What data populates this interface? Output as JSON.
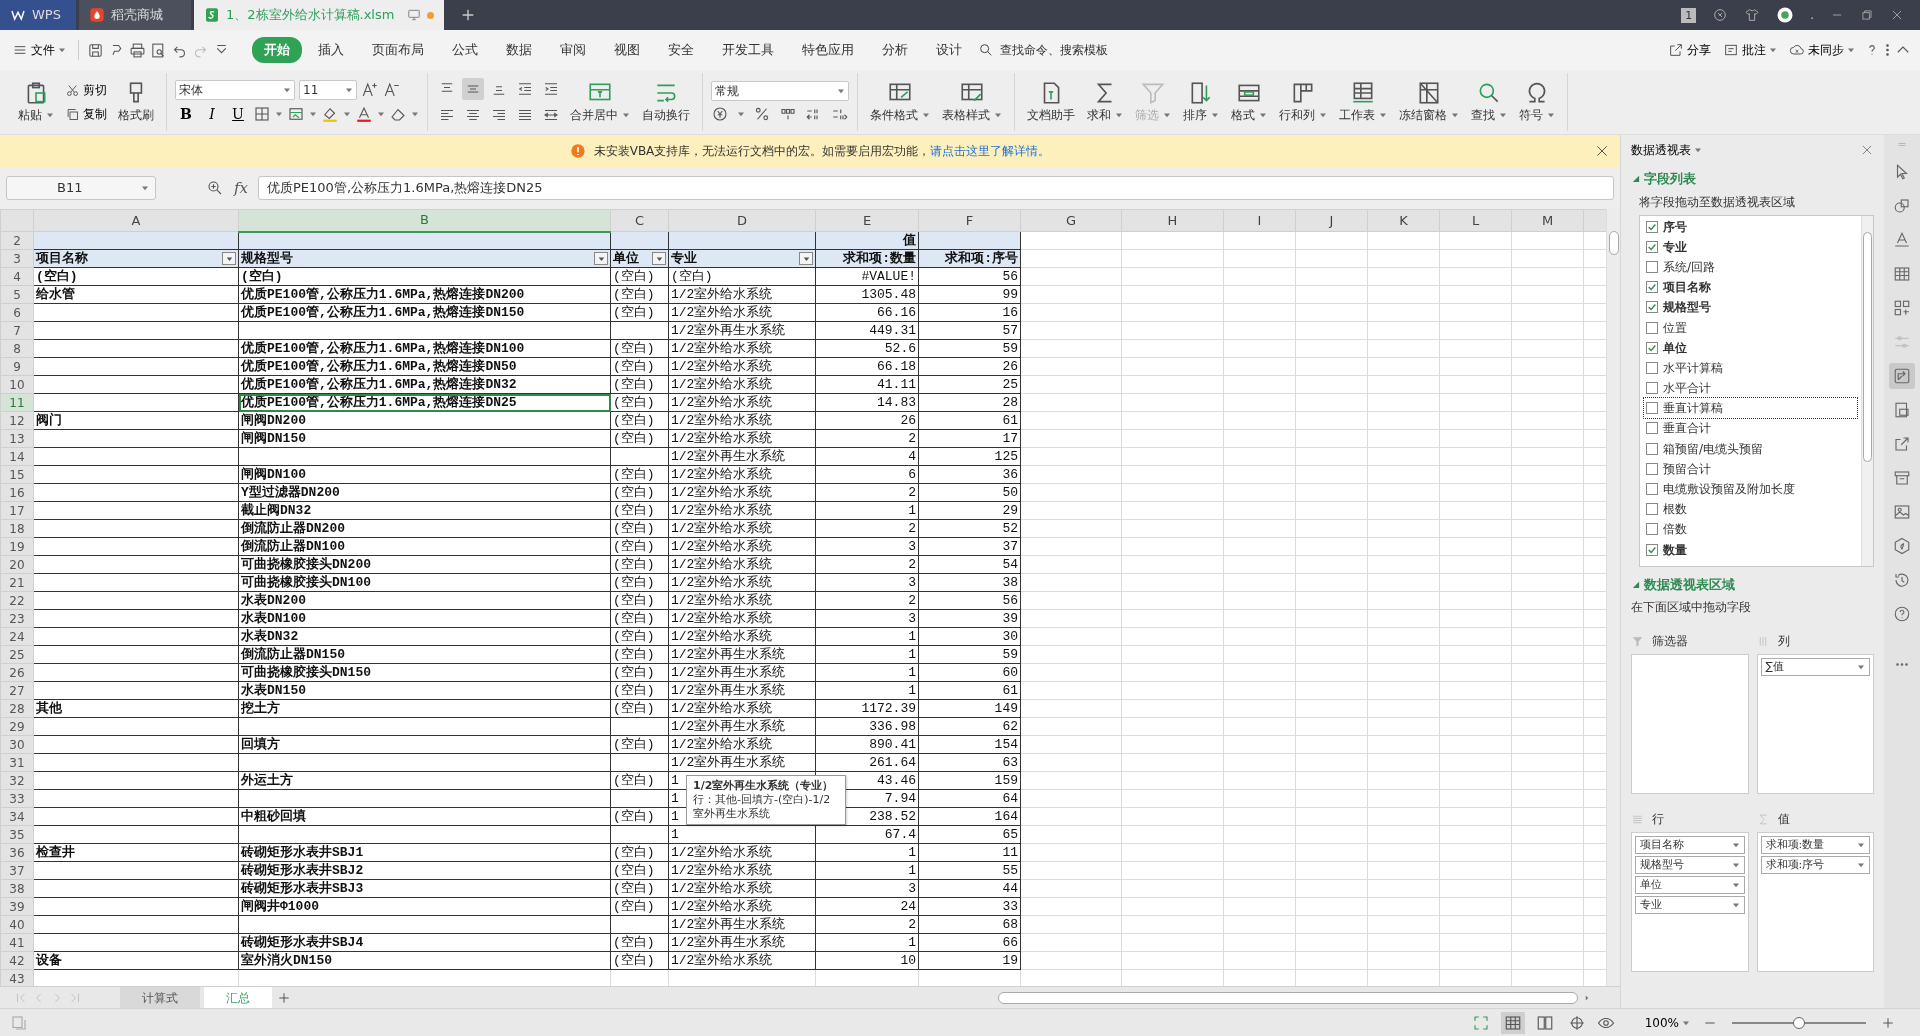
{
  "title_bar": {
    "tabs": [
      {
        "label": "WPS",
        "kind": "app",
        "selected": false,
        "modified": false
      },
      {
        "label": "稻壳商城",
        "kind": "store",
        "selected": false,
        "modified": false
      },
      {
        "label": "1、2栋室外给水计算稿.xlsm",
        "kind": "document",
        "selected": true,
        "modified": true
      }
    ],
    "window_badge": "1",
    "user": "."
  },
  "menu_bar": {
    "file": "文件",
    "tabs": [
      {
        "label": "开始",
        "selected": true
      },
      {
        "label": "插入",
        "selected": false
      },
      {
        "label": "页面布局",
        "selected": false
      },
      {
        "label": "公式",
        "selected": false
      },
      {
        "label": "数据",
        "selected": false
      },
      {
        "label": "审阅",
        "selected": false
      },
      {
        "label": "视图",
        "selected": false
      },
      {
        "label": "安全",
        "selected": false
      },
      {
        "label": "开发工具",
        "selected": false
      },
      {
        "label": "特色应用",
        "selected": false
      },
      {
        "label": "分析",
        "selected": false
      },
      {
        "label": "设计",
        "selected": false
      }
    ],
    "search": {
      "placeholder": "查找命令、搜索模板"
    },
    "actions": [
      {
        "label": "分享",
        "dropdown": false
      },
      {
        "label": "批注",
        "dropdown": true
      },
      {
        "label": "未同步",
        "dropdown": true
      }
    ]
  },
  "ribbon": {
    "paste": {
      "label": "粘贴",
      "dropdown": true
    },
    "clip_buttons": [
      "剪切",
      "复制"
    ],
    "format_painter": "格式刷",
    "font": {
      "name": "宋体",
      "size": "11"
    },
    "font_styles": [
      "B",
      "I",
      "U"
    ],
    "alignment_buttons": [
      {
        "selected": false
      },
      {
        "selected": true
      },
      {
        "selected": false
      },
      {
        "selected": false
      },
      {
        "selected": false
      },
      {
        "selected": false
      },
      {
        "selected": false
      },
      {
        "selected": false
      },
      {
        "selected": false
      },
      {
        "selected": false
      }
    ],
    "merge_buttons": [
      {
        "label": "合并居中",
        "dropdown": true
      },
      {
        "label": "自动换行",
        "dropdown": false
      }
    ],
    "number_format": "常规",
    "tools": [
      {
        "label": "条件格式",
        "dropdown": true,
        "disabled": false
      },
      {
        "label": "表格样式",
        "dropdown": true,
        "disabled": false
      },
      {
        "label": "文档助手",
        "dropdown": false,
        "disabled": false
      },
      {
        "label": "求和",
        "dropdown": true,
        "disabled": false
      },
      {
        "label": "筛选",
        "dropdown": true,
        "disabled": true
      },
      {
        "label": "排序",
        "dropdown": true,
        "disabled": false
      },
      {
        "label": "格式",
        "dropdown": true,
        "disabled": false
      },
      {
        "label": "行和列",
        "dropdown": true,
        "disabled": false
      },
      {
        "label": "工作表",
        "dropdown": true,
        "disabled": false
      },
      {
        "label": "冻结窗格",
        "dropdown": true,
        "disabled": false
      },
      {
        "label": "查找",
        "dropdown": true,
        "disabled": false
      },
      {
        "label": "符号",
        "dropdown": true,
        "disabled": false
      }
    ]
  },
  "notice": {
    "text": "未安装VBA支持库，无法运行文档中的宏。如需要启用宏功能，",
    "link": "请点击这里了解详情。"
  },
  "formula_bar": {
    "cell_ref": "B11",
    "fx": "fx",
    "formula": "优质PE100管,公称压力1.6MPa,热熔连接DN25"
  },
  "sheet": {
    "columns": [
      {
        "label": "A",
        "selected": false
      },
      {
        "label": "B",
        "selected": true
      },
      {
        "label": "C",
        "selected": false
      },
      {
        "label": "D",
        "selected": false
      },
      {
        "label": "E",
        "selected": false
      },
      {
        "label": "F",
        "selected": false
      },
      {
        "label": "G",
        "selected": false
      },
      {
        "label": "H",
        "selected": false
      },
      {
        "label": "I",
        "selected": false
      },
      {
        "label": "J",
        "selected": false
      },
      {
        "label": "K",
        "selected": false
      },
      {
        "label": "L",
        "selected": false
      },
      {
        "label": "M",
        "selected": false
      }
    ],
    "rows": [
      {
        "num": "2",
        "kind": "header",
        "selected": false,
        "cells": [
          null,
          null,
          null,
          null,
          "值",
          null
        ]
      },
      {
        "num": "3",
        "kind": "header",
        "selected": false,
        "cells": [
          "项目名称",
          "规格型号",
          "单位",
          "专业",
          "求和项:数量",
          "求和项:序号"
        ],
        "filters": [
          true,
          true,
          true,
          true,
          false,
          false
        ]
      },
      {
        "num": "4",
        "kind": "data",
        "selected": false,
        "cells": [
          "(空白)",
          "(空白)",
          "(空白)",
          "(空白)",
          "#VALUE!",
          "56"
        ]
      },
      {
        "num": "5",
        "kind": "data",
        "selected": false,
        "cells": [
          "给水管",
          "优质PE100管,公称压力1.6MPa,热熔连接DN200",
          "(空白)",
          "1/2室外给水系统",
          "1305.48",
          "99"
        ]
      },
      {
        "num": "6",
        "kind": "data",
        "selected": false,
        "cells": [
          null,
          "优质PE100管,公称压力1.6MPa,热熔连接DN150",
          "(空白)",
          "1/2室外给水系统",
          "66.16",
          "16"
        ]
      },
      {
        "num": "7",
        "kind": "data",
        "selected": false,
        "cells": [
          null,
          null,
          null,
          "1/2室外再生水系统",
          "449.31",
          "57"
        ]
      },
      {
        "num": "8",
        "kind": "data",
        "selected": false,
        "cells": [
          null,
          "优质PE100管,公称压力1.6MPa,热熔连接DN100",
          "(空白)",
          "1/2室外给水系统",
          "52.6",
          "59"
        ]
      },
      {
        "num": "9",
        "kind": "data",
        "selected": false,
        "cells": [
          null,
          "优质PE100管,公称压力1.6MPa,热熔连接DN50",
          "(空白)",
          "1/2室外给水系统",
          "66.18",
          "26"
        ]
      },
      {
        "num": "10",
        "kind": "data",
        "selected": false,
        "cells": [
          null,
          "优质PE100管,公称压力1.6MPa,热熔连接DN32",
          "(空白)",
          "1/2室外给水系统",
          "41.11",
          "25"
        ]
      },
      {
        "num": "11",
        "kind": "data",
        "selected": true,
        "cells": [
          null,
          "优质PE100管,公称压力1.6MPa,热熔连接DN25",
          "(空白)",
          "1/2室外给水系统",
          "14.83",
          "28"
        ]
      },
      {
        "num": "12",
        "kind": "data",
        "selected": false,
        "cells": [
          "阀门",
          "闸阀DN200",
          "(空白)",
          "1/2室外给水系统",
          "26",
          "61"
        ]
      },
      {
        "num": "13",
        "kind": "data",
        "selected": false,
        "cells": [
          null,
          "闸阀DN150",
          "(空白)",
          "1/2室外给水系统",
          "2",
          "17"
        ]
      },
      {
        "num": "14",
        "kind": "data",
        "selected": false,
        "cells": [
          null,
          null,
          null,
          "1/2室外再生水系统",
          "4",
          "125"
        ]
      },
      {
        "num": "15",
        "kind": "data",
        "selected": false,
        "cells": [
          null,
          "闸阀DN100",
          "(空白)",
          "1/2室外给水系统",
          "6",
          "36"
        ]
      },
      {
        "num": "16",
        "kind": "data",
        "selected": false,
        "cells": [
          null,
          "Y型过滤器DN200",
          "(空白)",
          "1/2室外给水系统",
          "2",
          "50"
        ]
      },
      {
        "num": "17",
        "kind": "data",
        "selected": false,
        "cells": [
          null,
          "截止阀DN32",
          "(空白)",
          "1/2室外给水系统",
          "1",
          "29"
        ]
      },
      {
        "num": "18",
        "kind": "data",
        "selected": false,
        "cells": [
          null,
          "倒流防止器DN200",
          "(空白)",
          "1/2室外给水系统",
          "2",
          "52"
        ]
      },
      {
        "num": "19",
        "kind": "data",
        "selected": false,
        "cells": [
          null,
          "倒流防止器DN100",
          "(空白)",
          "1/2室外给水系统",
          "3",
          "37"
        ]
      },
      {
        "num": "20",
        "kind": "data",
        "selected": false,
        "cells": [
          null,
          "可曲挠橡胶接头DN200",
          "(空白)",
          "1/2室外给水系统",
          "2",
          "54"
        ]
      },
      {
        "num": "21",
        "kind": "data",
        "selected": false,
        "cells": [
          null,
          "可曲挠橡胶接头DN100",
          "(空白)",
          "1/2室外给水系统",
          "3",
          "38"
        ]
      },
      {
        "num": "22",
        "kind": "data",
        "selected": false,
        "cells": [
          null,
          "水表DN200",
          "(空白)",
          "1/2室外给水系统",
          "2",
          "56"
        ]
      },
      {
        "num": "23",
        "kind": "data",
        "selected": false,
        "cells": [
          null,
          "水表DN100",
          "(空白)",
          "1/2室外给水系统",
          "3",
          "39"
        ]
      },
      {
        "num": "24",
        "kind": "data",
        "selected": false,
        "cells": [
          null,
          "水表DN32",
          "(空白)",
          "1/2室外给水系统",
          "1",
          "30"
        ]
      },
      {
        "num": "25",
        "kind": "data",
        "selected": false,
        "cells": [
          null,
          "倒流防止器DN150",
          "(空白)",
          "1/2室外再生水系统",
          "1",
          "59"
        ]
      },
      {
        "num": "26",
        "kind": "data",
        "selected": false,
        "cells": [
          null,
          "可曲挠橡胶接头DN150",
          "(空白)",
          "1/2室外再生水系统",
          "1",
          "60"
        ]
      },
      {
        "num": "27",
        "kind": "data",
        "selected": false,
        "cells": [
          null,
          "水表DN150",
          "(空白)",
          "1/2室外再生水系统",
          "1",
          "61"
        ]
      },
      {
        "num": "28",
        "kind": "data",
        "selected": false,
        "cells": [
          "其他",
          "挖土方",
          "(空白)",
          "1/2室外给水系统",
          "1172.39",
          "149"
        ]
      },
      {
        "num": "29",
        "kind": "data",
        "selected": false,
        "cells": [
          null,
          null,
          null,
          "1/2室外再生水系统",
          "336.98",
          "62"
        ]
      },
      {
        "num": "30",
        "kind": "data",
        "selected": false,
        "cells": [
          null,
          "回填方",
          "(空白)",
          "1/2室外给水系统",
          "890.41",
          "154"
        ]
      },
      {
        "num": "31",
        "kind": "data",
        "selected": false,
        "cells": [
          null,
          null,
          null,
          "1/2室外再生水系统",
          "261.64",
          "63"
        ]
      },
      {
        "num": "32",
        "kind": "data",
        "selected": false,
        "cells": [
          null,
          "外运土方",
          "(空白)",
          "1",
          "43.46",
          "159"
        ]
      },
      {
        "num": "33",
        "kind": "data",
        "selected": false,
        "cells": [
          null,
          null,
          null,
          "1",
          "7.94",
          "64"
        ]
      },
      {
        "num": "34",
        "kind": "data",
        "selected": false,
        "cells": [
          null,
          "中粗砂回填",
          "(空白)",
          "1",
          "238.52",
          "164"
        ]
      },
      {
        "num": "35",
        "kind": "data",
        "selected": false,
        "cells": [
          null,
          null,
          null,
          "1",
          "67.4",
          "65"
        ]
      },
      {
        "num": "36",
        "kind": "data",
        "selected": false,
        "cells": [
          "检查井",
          "砖砌矩形水表井SBJ1",
          "(空白)",
          "1/2室外给水系统",
          "1",
          "11"
        ]
      },
      {
        "num": "37",
        "kind": "data",
        "selected": false,
        "cells": [
          null,
          "砖砌矩形水表井SBJ2",
          "(空白)",
          "1/2室外给水系统",
          "1",
          "55"
        ]
      },
      {
        "num": "38",
        "kind": "data",
        "selected": false,
        "cells": [
          null,
          "砖砌矩形水表井SBJ3",
          "(空白)",
          "1/2室外给水系统",
          "3",
          "44"
        ]
      },
      {
        "num": "39",
        "kind": "data",
        "selected": false,
        "cells": [
          null,
          "闸阀井Φ1000",
          "(空白)",
          "1/2室外给水系统",
          "24",
          "33"
        ]
      },
      {
        "num": "40",
        "kind": "data",
        "selected": false,
        "cells": [
          null,
          null,
          null,
          "1/2室外再生水系统",
          "2",
          "68"
        ]
      },
      {
        "num": "41",
        "kind": "data",
        "selected": false,
        "cells": [
          null,
          "砖砌矩形水表井SBJ4",
          "(空白)",
          "1/2室外再生水系统",
          "1",
          "66"
        ]
      },
      {
        "num": "42",
        "kind": "data",
        "selected": false,
        "cells": [
          "设备",
          "室外消火DN150",
          "(空白)",
          "1/2室外给水系统",
          "10",
          "19"
        ]
      },
      {
        "num": "43",
        "kind": "blank",
        "selected": false
      }
    ],
    "tooltip": {
      "title": "1/2室外再生水系统（专业）",
      "text": "行：其他-回填方-(空白)-1/2室外再生水系统"
    }
  },
  "sheet_tabs": [
    {
      "label": "计算式",
      "selected": false
    },
    {
      "label": "汇总",
      "selected": true
    }
  ],
  "pivot_panel": {
    "title": "数据透视表",
    "field_list": {
      "title": "字段列表",
      "hint": "将字段拖动至数据透视表区域",
      "fields": [
        {
          "label": "序号",
          "checked": true,
          "focused": false
        },
        {
          "label": "专业",
          "checked": true,
          "focused": false
        },
        {
          "label": "系统/回路",
          "checked": false,
          "focused": false
        },
        {
          "label": "项目名称",
          "checked": true,
          "focused": false
        },
        {
          "label": "规格型号",
          "checked": true,
          "focused": false
        },
        {
          "label": "位置",
          "checked": false,
          "focused": false
        },
        {
          "label": "单位",
          "checked": true,
          "focused": false
        },
        {
          "label": "水平计算稿",
          "checked": false,
          "focused": false
        },
        {
          "label": "水平合计",
          "checked": false,
          "focused": false
        },
        {
          "label": "垂直计算稿",
          "checked": false,
          "focused": true
        },
        {
          "label": "垂直合计",
          "checked": false,
          "focused": false
        },
        {
          "label": "箱预留/电缆头预留",
          "checked": false,
          "focused": false
        },
        {
          "label": "预留合计",
          "checked": false,
          "focused": false
        },
        {
          "label": "电缆敷设预留及附加长度",
          "checked": false,
          "focused": false
        },
        {
          "label": "根数",
          "checked": false,
          "focused": false
        },
        {
          "label": "倍数",
          "checked": false,
          "focused": false
        },
        {
          "label": "数量",
          "checked": true,
          "focused": false
        }
      ]
    },
    "areas": {
      "title": "数据透视表区域",
      "hint": "在下面区域中拖动字段",
      "zones": [
        {
          "label": "筛选器"
        },
        {
          "label": "列",
          "items": [
            "∑值"
          ]
        },
        {
          "label": "行",
          "items": [
            "项目名称",
            "规格型号",
            "单位",
            "专业"
          ]
        },
        {
          "label": "值",
          "items": [
            "求和项:数量",
            "求和项:序号"
          ]
        }
      ]
    }
  },
  "side_tools": [
    {
      "selected": false
    },
    {
      "selected": false
    },
    {
      "selected": false
    },
    {
      "selected": false
    },
    {
      "selected": false
    },
    {
      "selected": false
    },
    {
      "selected": true
    },
    {
      "selected": false
    },
    {
      "selected": false
    },
    {
      "selected": false
    },
    {
      "selected": false
    },
    {
      "selected": false
    },
    {
      "selected": false
    },
    {
      "selected": false
    },
    {
      "selected": false
    }
  ],
  "status_bar": {
    "views": [
      {
        "selected": false
      },
      {
        "selected": true
      },
      {
        "selected": false
      },
      {
        "selected": false
      }
    ],
    "zoom": "100%",
    "zoom_slider": {
      "level": 0.5
    }
  }
}
